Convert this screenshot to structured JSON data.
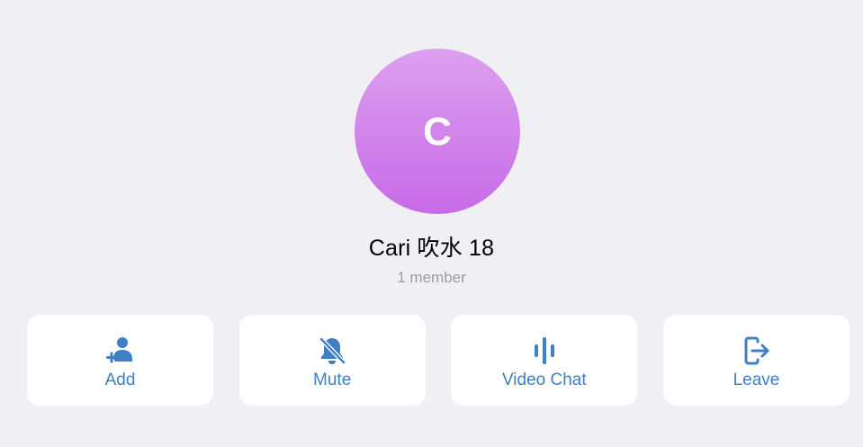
{
  "chat": {
    "avatar_initial": "C",
    "title": "Cari 吹水 18",
    "subtitle": "1 member"
  },
  "actions": [
    {
      "label": "Add",
      "icon": "add-member-icon"
    },
    {
      "label": "Mute",
      "icon": "bell-slash-icon"
    },
    {
      "label": "Video Chat",
      "icon": "voice-chat-waveform-icon"
    },
    {
      "label": "Leave",
      "icon": "leave-door-icon"
    }
  ],
  "colors": {
    "background": "#efeff4",
    "accent": "#3f7fc4",
    "avatar_top": "#dca1ef",
    "avatar_bottom": "#c86ae8",
    "subtitle": "#9b9ba1"
  }
}
